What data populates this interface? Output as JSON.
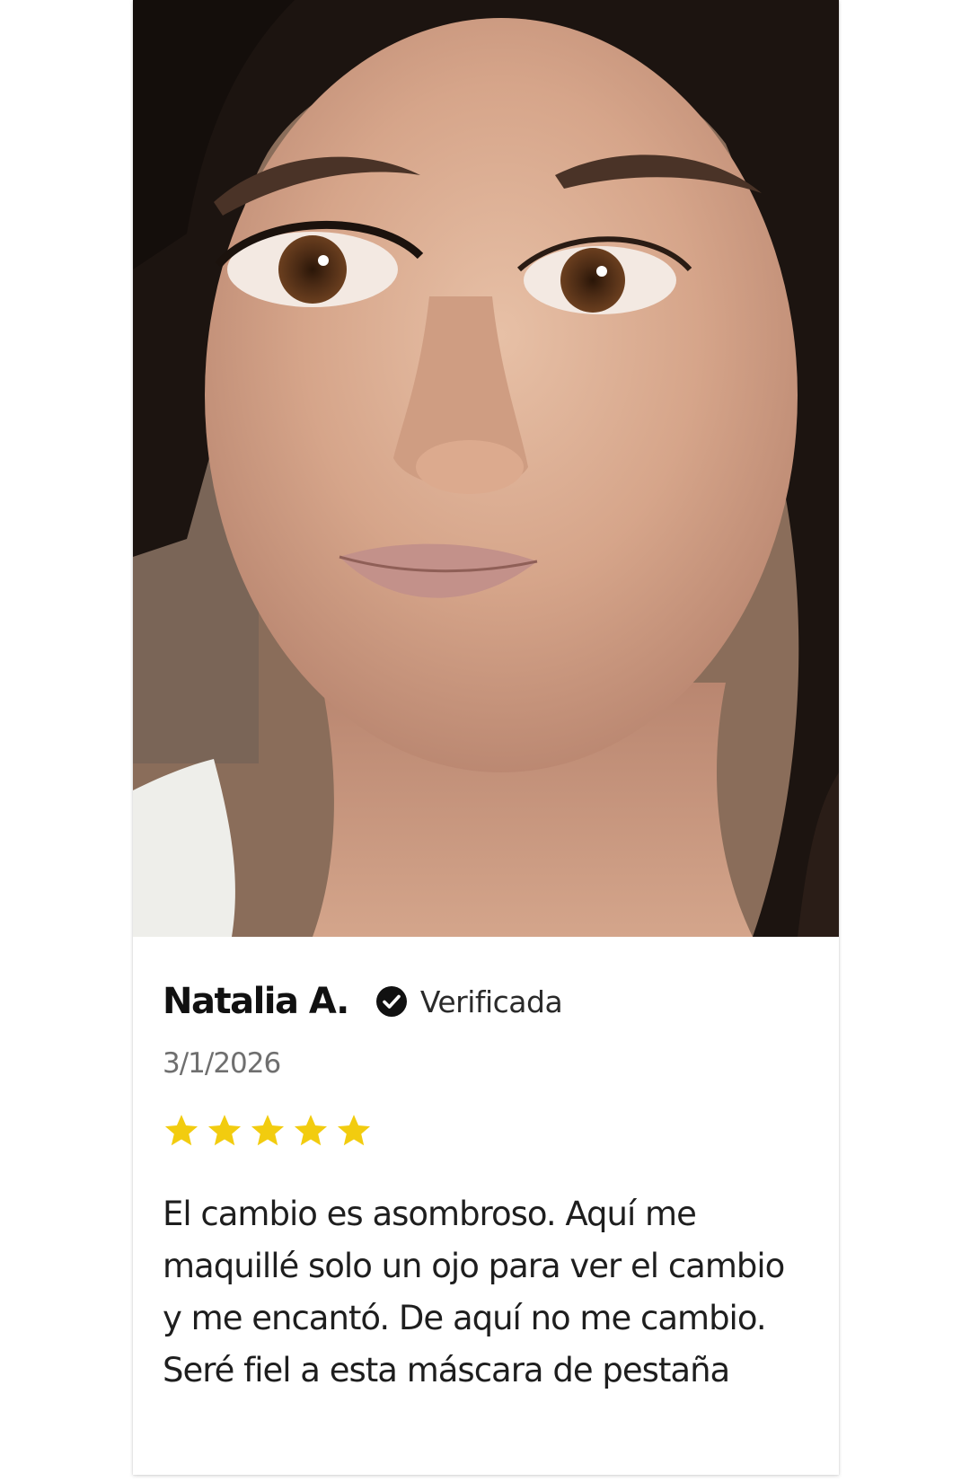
{
  "review": {
    "reviewer_name": "Natalia A.",
    "verified_label": "Verificada",
    "verified_icon": "check-circle-icon",
    "date": "3/1/2026",
    "rating": 5,
    "rating_max": 5,
    "star_color": "#F2CC0F",
    "text": "El cambio es asombroso. Aquí me maquillé solo un ojo para ver el cambio y me encantó. De aquí no me cambio. Seré fiel a esta máscara de pestaña"
  }
}
